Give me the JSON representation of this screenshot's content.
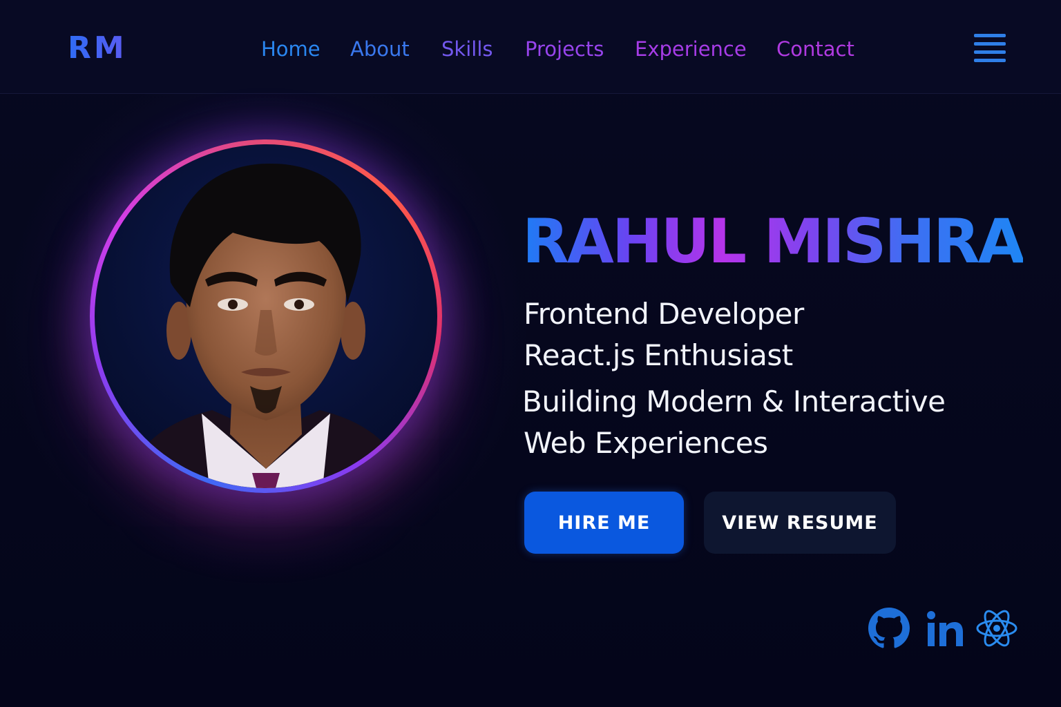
{
  "brand": {
    "logo_text": "RM"
  },
  "nav": {
    "items": [
      {
        "label": "Home",
        "color": "#2a86ef"
      },
      {
        "label": "About",
        "color": "#3a78ee"
      },
      {
        "label": "Skills",
        "color": "#7358ee"
      },
      {
        "label": "Projects",
        "color": "#9744ec"
      },
      {
        "label": "Experience",
        "color": "#a63ce6"
      },
      {
        "label": "Contact",
        "color": "#b03ae0"
      }
    ],
    "menu_icon": "hamburger-menu-icon"
  },
  "hero": {
    "name": "RAHUL MISHRA",
    "role_1": "Frontend Developer",
    "role_2": "React.js Enthusiast",
    "tagline_1": "Building Modern & Interactive",
    "tagline_2": "Web Experiences",
    "primary_button": "HIRE ME",
    "secondary_button": "VIEW RESUME"
  },
  "social": [
    {
      "icon": "github-icon",
      "color": "#1e6fd8"
    },
    {
      "icon": "linkedin-icon",
      "color": "#1e6fd8"
    },
    {
      "icon": "react-icon",
      "color": "#2a8cf0"
    }
  ],
  "colors": {
    "background": "#05061a",
    "accent_blue": "#0a58df",
    "accent_purple": "#b634ea"
  }
}
